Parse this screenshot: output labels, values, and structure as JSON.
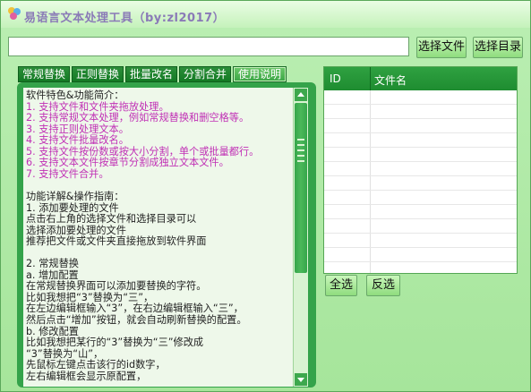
{
  "app": {
    "title": "易语言文本处理工具（by:zl2017）"
  },
  "toolbar": {
    "path_value": "",
    "select_file_label": "选择文件",
    "select_dir_label": "选择目录"
  },
  "tabs": [
    {
      "label": "常规替换",
      "active": false
    },
    {
      "label": "正则替换",
      "active": false
    },
    {
      "label": "批量改名",
      "active": false
    },
    {
      "label": "分割合并",
      "active": false
    },
    {
      "label": "使用说明",
      "active": true
    }
  ],
  "doc": {
    "lines": [
      {
        "text": "软件特色&功能简介：",
        "magenta": false
      },
      {
        "text": "1. 支持文件和文件夹拖放处理。",
        "magenta": true
      },
      {
        "text": "2. 支持常规文本处理，例如常规替换和删空格等。",
        "magenta": true
      },
      {
        "text": "3. 支持正则处理文本。",
        "magenta": true
      },
      {
        "text": "4. 支持文件批量改名。",
        "magenta": true
      },
      {
        "text": "5. 支持文件按份数或按大小分割，单个或批量都行。",
        "magenta": true
      },
      {
        "text": "6. 支持文本文件按章节分割成独立文本文件。",
        "magenta": true
      },
      {
        "text": "7. 支持文件合并。",
        "magenta": true
      },
      {
        "text": "",
        "magenta": false
      },
      {
        "text": "功能详解&操作指南：",
        "magenta": false
      },
      {
        "text": "1. 添加要处理的文件",
        "magenta": false
      },
      {
        "text": "点击右上角的选择文件和选择目录可以",
        "magenta": false
      },
      {
        "text": "选择添加要处理的文件",
        "magenta": false
      },
      {
        "text": "推荐把文件或文件夹直接拖放到软件界面",
        "magenta": false
      },
      {
        "text": "",
        "magenta": false
      },
      {
        "text": "2. 常规替换",
        "magenta": false
      },
      {
        "text": "a. 增加配置",
        "magenta": false
      },
      {
        "text": "在常规替换界面可以添加要替换的字符。",
        "magenta": false
      },
      {
        "text": "比如我想把“3”替换为“三”，",
        "magenta": false
      },
      {
        "text": "在左边编辑框输入“3”，在右边编辑框输入“三”，",
        "magenta": false
      },
      {
        "text": "然后点击“增加”按钮，就会自动刷新替换的配置。",
        "magenta": false
      },
      {
        "text": "b. 修改配置",
        "magenta": false
      },
      {
        "text": "比如我想把某行的“3”替换为“三”修改成",
        "magenta": false
      },
      {
        "text": "“3”替换为“山”，",
        "magenta": false
      },
      {
        "text": "先鼠标左键点击该行的id数字，",
        "magenta": false
      },
      {
        "text": "左右编辑框会显示原配置，",
        "magenta": false
      }
    ]
  },
  "filelist": {
    "headers": {
      "id": "ID",
      "name": "文件名"
    },
    "rows": []
  },
  "actions": {
    "select_all_label": "全选",
    "invert_label": "反选"
  },
  "colors": {
    "tab_green": "#1a8a2c",
    "panel_green": "#34a34a",
    "magenta_text": "#c02fb5"
  }
}
